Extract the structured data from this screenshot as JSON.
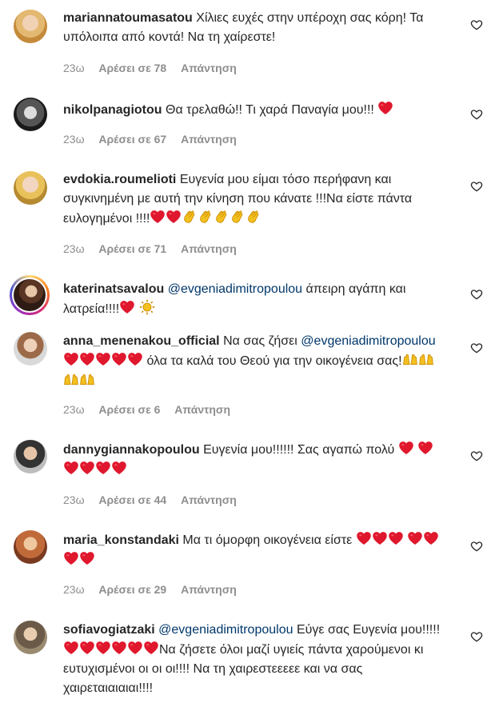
{
  "comments": [
    {
      "username": "mariannatoumasatou",
      "text": "Χίλιες ευχές στην υπέροχη σας κόρη! Τα υπόλοιπα από κοντά! Να τη χαίρεστε!",
      "time": "23ω",
      "likes": "Αρέσει σε 78",
      "reply": "Απάντηση"
    },
    {
      "username": "nikolpanagiotou",
      "text": "Θα τρελαθώ!! Τι χαρά Παναγία μου!!!",
      "time": "23ω",
      "likes": "Αρέσει σε 67",
      "reply": "Απάντηση"
    },
    {
      "username": "evdokia.roumelioti",
      "text": "Ευγενία μου είμαι τόσο περήφανη και συγκινημένη με αυτή την κίνηση που κάνατε !!!Να είστε πάντα ευλογημένοι !!!!",
      "time": "23ω",
      "likes": "Αρέσει σε 71",
      "reply": "Απάντηση"
    },
    {
      "username": "katerinatsavalou",
      "mention": "@evgeniadimitropoulou",
      "text": "άπειρη αγάπη και λατρεία!!!!",
      "time": "",
      "likes": "",
      "reply": ""
    },
    {
      "username": "anna_menenakou_official",
      "text": "Να σας ζήσει",
      "mention": "@evgeniadimitropoulou",
      "text2": "όλα τα καλά του Θεού για την οικογένεια σας!",
      "time": "23ω",
      "likes": "Αρέσει σε 6",
      "reply": "Απάντηση"
    },
    {
      "username": "dannygiannakopoulou",
      "text": "Ευγενία μου!!!!!! Σας αγαπώ πολύ",
      "time": "23ω",
      "likes": "Αρέσει σε 44",
      "reply": "Απάντηση"
    },
    {
      "username": "maria_konstandaki",
      "text": "Μα τι όμορφη οικογένεια είστε",
      "time": "23ω",
      "likes": "Αρέσει σε 29",
      "reply": "Απάντηση"
    },
    {
      "username": "sofiavogiatzaki",
      "mention": "@evgeniadimitropoulou",
      "text": "Εύγε σας Ευγενία μου!!!!!",
      "text2": "Να ζήσετε όλοι μαζί υγιείς πάντα χαρούμενοι κι ευτυχισμένοι οι οι οι!!!! Να τη χαιρεστεεεεε και να σας χαιρεταιαιαιαι!!!!",
      "time": "",
      "likes": "",
      "reply": ""
    }
  ],
  "icons": {
    "like": "heart-outline-icon",
    "emoji_heart": "red-heart-emoji",
    "emoji_clap": "clapping-hands-emoji",
    "emoji_raise": "raising-hands-emoji",
    "emoji_sun": "sun-emoji"
  },
  "colors": {
    "mention": "#00376b",
    "meta": "#8e8e8e",
    "heart_emoji": "#e0182d"
  }
}
